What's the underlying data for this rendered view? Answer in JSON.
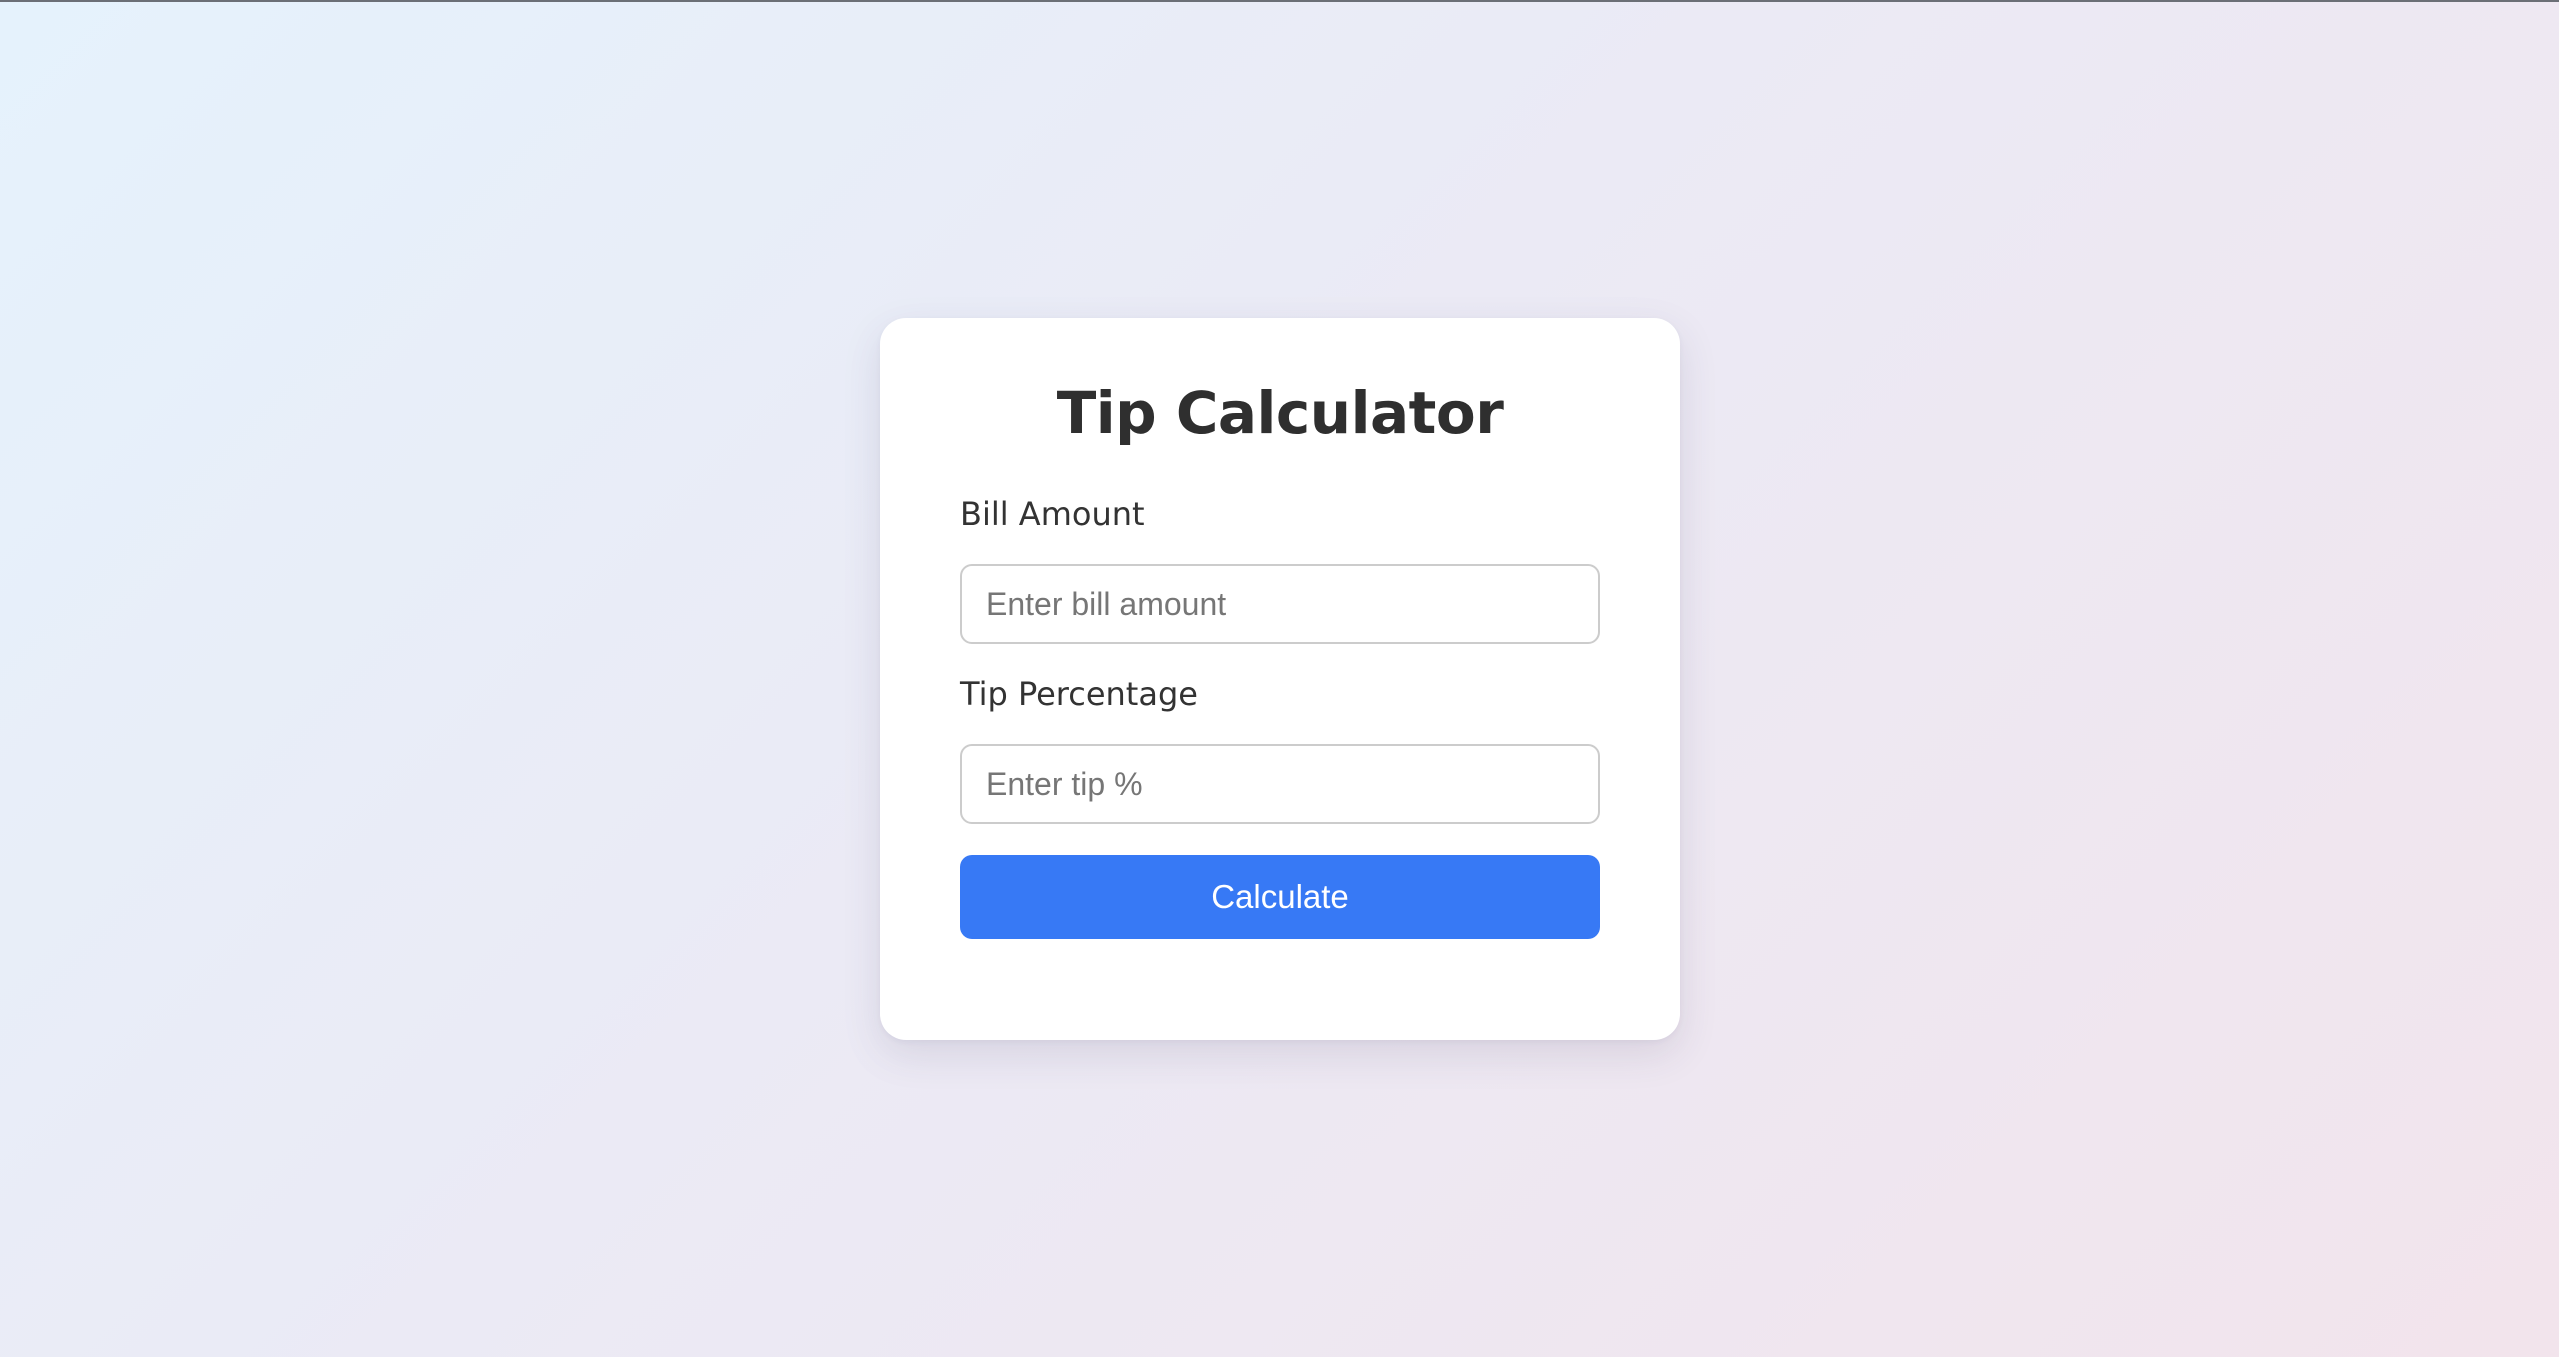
{
  "page": {
    "background_start": "#e5f2fc",
    "background_end": "#f2e4ec"
  },
  "calculator": {
    "title": "Tip Calculator",
    "bill_label": "Bill Amount",
    "bill_placeholder": "Enter bill amount",
    "bill_value": "",
    "tip_label": "Tip Percentage",
    "tip_placeholder": "Enter tip %",
    "tip_value": "",
    "calculate_label": "Calculate",
    "accent_color": "#3779f5",
    "card_color": "#ffffff"
  }
}
